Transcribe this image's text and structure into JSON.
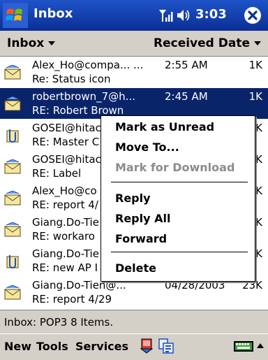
{
  "titlebar": {
    "title": "Inbox",
    "time": "3:03"
  },
  "header": {
    "folder": "Inbox",
    "sort": "Received Date"
  },
  "messages": [
    {
      "from": "Alex_Ho@compa... ...",
      "time": "2:55 AM",
      "size": "1K",
      "subject": "Re: Status icon",
      "icon": "envelope-icon"
    },
    {
      "from": "robertbrown_7@h...",
      "time": "2:45 AM",
      "size": "1K",
      "subject": "RE: Robert Brown",
      "icon": "envelope-icon",
      "selected": true
    },
    {
      "from": "GOSEI@hitac",
      "time": "",
      "size": "K",
      "subject": "RE: Master C",
      "icon": "attachment-icon"
    },
    {
      "from": "GOSEI@hitac",
      "time": "",
      "size": "0K",
      "subject": "RE: Label",
      "icon": "envelope-icon"
    },
    {
      "from": "Alex_Ho@co",
      "time": "",
      "size": "4K",
      "subject": "RE: report 4/",
      "icon": "envelope-icon"
    },
    {
      "from": "Giang.Do-Tie",
      "time": "",
      "size": "0K",
      "subject": "RE: workaro",
      "icon": "envelope-icon"
    },
    {
      "from": "Giang.Do-Tie",
      "time": "",
      "size": "2K",
      "subject": "RE: new AP I",
      "icon": "attachment-icon"
    },
    {
      "from": "Giang.Do-Tien@...",
      "time": "04/28/2003",
      "size": "23K",
      "subject": "RE: report 4/29",
      "icon": "envelope-icon"
    }
  ],
  "context_menu": {
    "items": [
      "Mark as Unread",
      "Move To...",
      "Mark for Download",
      "Reply",
      "Reply All",
      "Forward",
      "Delete"
    ]
  },
  "status": {
    "text": "Inbox: POP3 8 Items."
  },
  "command_bar": {
    "new": "New",
    "tools": "Tools",
    "services": "Services"
  },
  "colors": {
    "titlebar": "#0b2f95",
    "selection": "#0a246a",
    "chrome": "#d4d0c8"
  }
}
